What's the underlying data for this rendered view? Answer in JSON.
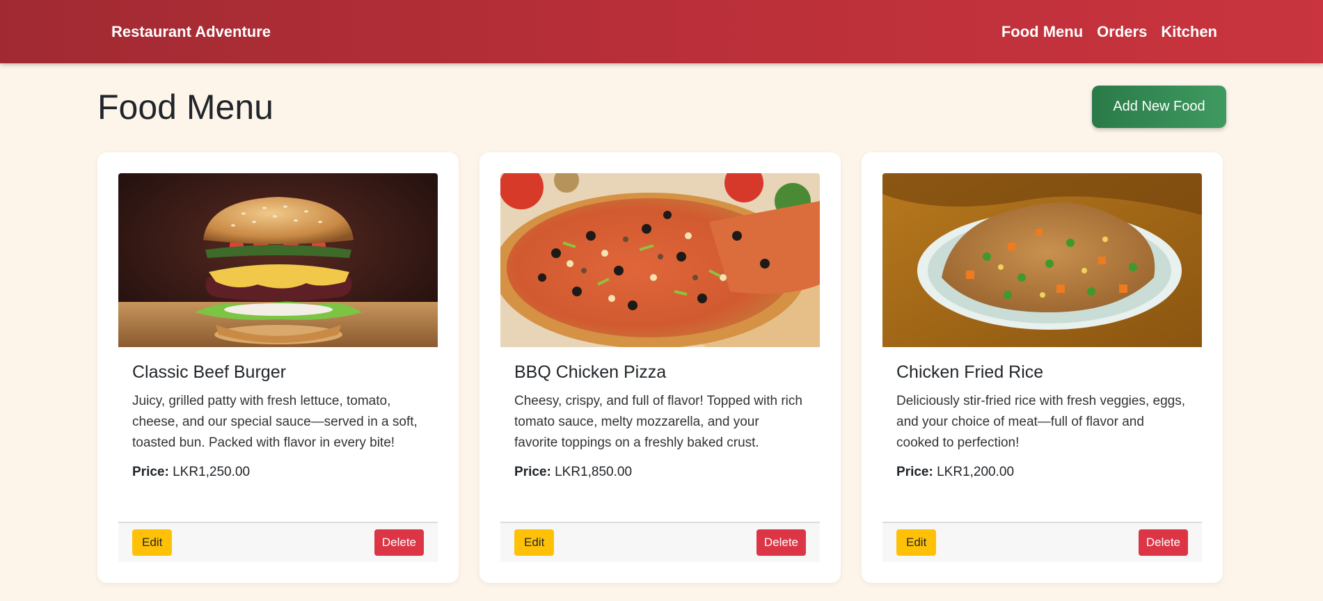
{
  "navbar": {
    "brand": "Restaurant Adventure",
    "links": [
      "Food Menu",
      "Orders",
      "Kitchen"
    ]
  },
  "page": {
    "title": "Food Menu",
    "add_button": "Add New Food"
  },
  "price_label": "Price:",
  "cards": [
    {
      "title": "Classic Beef Burger",
      "description": "Juicy, grilled patty with fresh lettuce, tomato, cheese, and our special sauce—served in a soft, toasted bun. Packed with flavor in every bite!",
      "price": "LKR1,250.00",
      "edit": "Edit",
      "delete": "Delete",
      "image": "burger-photo"
    },
    {
      "title": "BBQ Chicken Pizza",
      "description": "Cheesy, crispy, and full of flavor! Topped with rich tomato sauce, melty mozzarella, and your favorite toppings on a freshly baked crust.",
      "price": "LKR1,850.00",
      "edit": "Edit",
      "delete": "Delete",
      "image": "pizza-photo"
    },
    {
      "title": "Chicken Fried Rice",
      "description": "Deliciously stir-fried rice with fresh veggies, eggs, and your choice of meat—full of flavor and cooked to perfection!",
      "price": "LKR1,200.00",
      "edit": "Edit",
      "delete": "Delete",
      "image": "fried-rice-photo"
    }
  ],
  "colors": {
    "navbar": "#b92f39",
    "background": "#fdf5ea",
    "add_button": "#2f8650",
    "edit_button": "#ffc107",
    "delete_button": "#dc3545"
  }
}
